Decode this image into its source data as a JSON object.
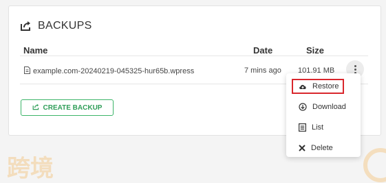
{
  "watermark": {
    "text": "科灯跨境",
    "bottom_text": "跨境"
  },
  "card": {
    "title": "BACKUPS",
    "title_icon": "share-box-icon"
  },
  "table": {
    "headers": {
      "name": "Name",
      "date": "Date",
      "size": "Size"
    },
    "rows": [
      {
        "file_icon": "file-icon",
        "name": "example.com-20240219-045325-hur65b.wpress",
        "date": "7 mins ago",
        "size": "101.91 MB"
      }
    ]
  },
  "create_backup": {
    "label": "CREATE BACKUP",
    "icon": "share-box-icon"
  },
  "menu": {
    "items": [
      {
        "label": "Restore",
        "icon": "cloud-upload-icon",
        "highlighted": true
      },
      {
        "label": "Download",
        "icon": "download-circle-icon"
      },
      {
        "label": "List",
        "icon": "list-icon"
      },
      {
        "label": "Delete",
        "icon": "close-icon"
      }
    ]
  },
  "colors": {
    "accent_green": "#3bb468",
    "highlight_red": "#d9262c",
    "watermark": "#f3d9b4"
  }
}
